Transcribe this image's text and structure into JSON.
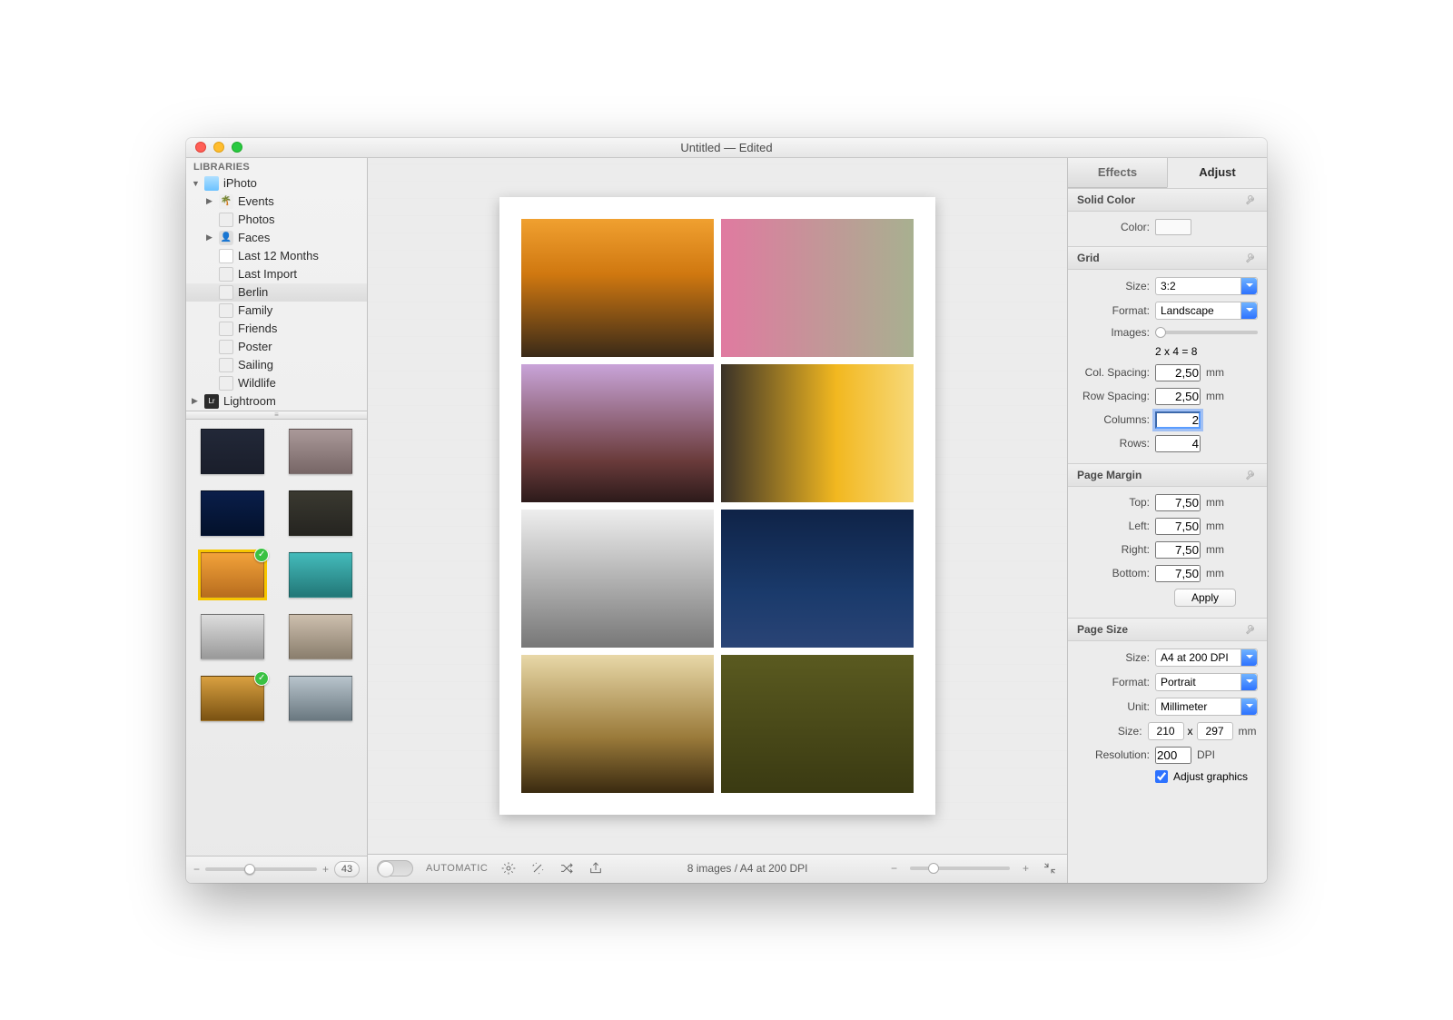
{
  "window": {
    "title": "Untitled  —  Edited"
  },
  "sidebar": {
    "header": "LIBRARIES",
    "iphoto_label": "iPhoto",
    "lightroom_label": "Lightroom",
    "items": {
      "events": "Events",
      "photos": "Photos",
      "faces": "Faces",
      "last12": "Last 12 Months",
      "lastimport": "Last Import",
      "berlin": "Berlin",
      "family": "Family",
      "friends": "Friends",
      "poster": "Poster",
      "sailing": "Sailing",
      "wildlife": "Wildlife"
    },
    "thumb_count": "43"
  },
  "bottom": {
    "automatic": "AUTOMATIC",
    "status": "8 images / A4 at 200 DPI"
  },
  "inspector": {
    "tabs": {
      "effects": "Effects",
      "adjust": "Adjust"
    },
    "solid_color": {
      "title": "Solid Color",
      "color_label": "Color:"
    },
    "grid": {
      "title": "Grid",
      "size_label": "Size:",
      "size_value": "3:2",
      "format_label": "Format:",
      "format_value": "Landscape",
      "images_label": "Images:",
      "images_formula": "2 x 4 = 8",
      "col_spacing_label": "Col. Spacing:",
      "col_spacing_value": "2,50",
      "row_spacing_label": "Row Spacing:",
      "row_spacing_value": "2,50",
      "columns_label": "Columns:",
      "columns_value": "2",
      "rows_label": "Rows:",
      "rows_value": "4",
      "unit_mm": "mm"
    },
    "page_margin": {
      "title": "Page Margin",
      "top_label": "Top:",
      "top_value": "7,50",
      "left_label": "Left:",
      "left_value": "7,50",
      "right_label": "Right:",
      "right_value": "7,50",
      "bottom_label": "Bottom:",
      "bottom_value": "7,50",
      "apply": "Apply",
      "unit_mm": "mm"
    },
    "page_size": {
      "title": "Page Size",
      "size_label": "Size:",
      "size_value": "A4 at 200 DPI",
      "format_label": "Format:",
      "format_value": "Portrait",
      "unit_label": "Unit:",
      "unit_value": "Millimeter",
      "dim_label": "Size:",
      "width": "210",
      "x": "x",
      "height": "297",
      "unit_mm": "mm",
      "res_label": "Resolution:",
      "res_value": "200",
      "dpi": "DPI",
      "adjust_graphics": "Adjust graphics"
    }
  }
}
